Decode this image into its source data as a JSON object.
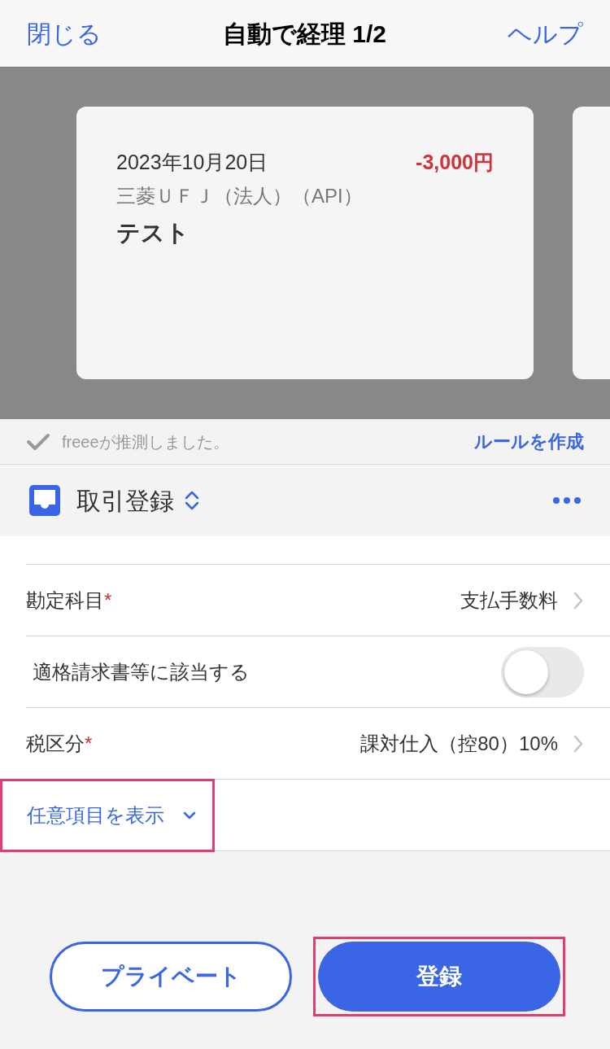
{
  "nav": {
    "close": "閉じる",
    "title": "自動で経理 1/2",
    "help": "ヘルプ"
  },
  "card": {
    "date": "2023年10月20日",
    "amount": "-3,000円",
    "account": "三菱ＵＦＪ（法人）（API）",
    "description": "テスト"
  },
  "guess": {
    "text": "freeeが推測しました。",
    "link": "ルールを作成"
  },
  "section": {
    "title": "取引登録"
  },
  "rows": [
    {
      "kind": "select",
      "label": "勘定科目",
      "required_mark": "*",
      "value": "支払手数料"
    },
    {
      "kind": "toggle",
      "label": "適格請求書等に該当する",
      "on": false
    },
    {
      "kind": "select",
      "label": "税区分",
      "required_mark": "*",
      "value": "課対仕入（控80）10%"
    }
  ],
  "more": {
    "label": "任意項目を表示",
    "highlighted": true
  },
  "buttons": [
    {
      "label": "プライベート",
      "kind": "outline",
      "highlighted": false
    },
    {
      "label": "登録",
      "kind": "primary",
      "highlighted": true
    }
  ]
}
